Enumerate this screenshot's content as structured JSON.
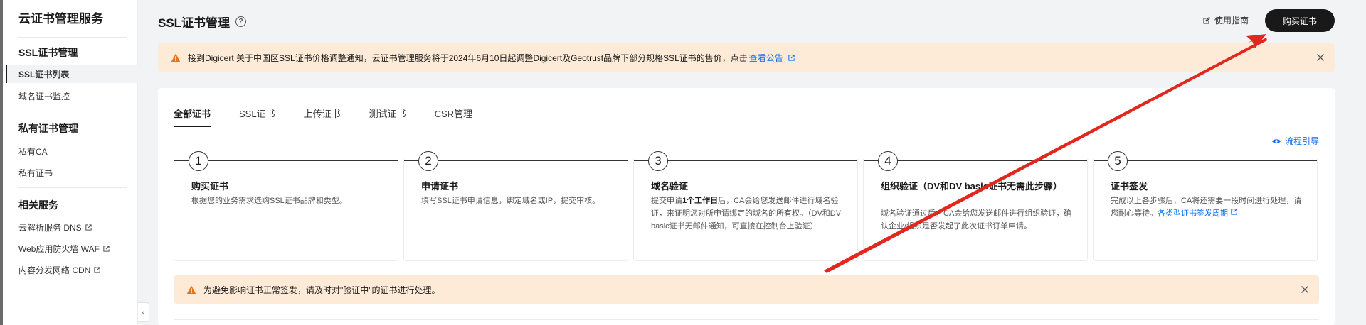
{
  "sidebar": {
    "title": "云证书管理服务",
    "groups": [
      {
        "label": "SSL证书管理",
        "items": [
          {
            "label": "SSL证书列表",
            "active": true
          },
          {
            "label": "域名证书监控"
          }
        ]
      },
      {
        "label": "私有证书管理",
        "items": [
          {
            "label": "私有CA"
          },
          {
            "label": "私有证书"
          }
        ]
      },
      {
        "label": "相关服务",
        "items": [
          {
            "label": "云解析服务 DNS",
            "external": true
          },
          {
            "label": "Web应用防火墙 WAF",
            "external": true
          },
          {
            "label": "内容分发网络 CDN",
            "external": true
          }
        ]
      }
    ]
  },
  "header": {
    "title": "SSL证书管理",
    "guide_label": "使用指南",
    "buy_label": "购买证书"
  },
  "top_notice": {
    "text": "接到Digicert 关于中国区SSL证书价格调整通知，云证书管理服务将于2024年6月10日起调整Digicert及Geotrust品牌下部分规格SSL证书的售价，点击",
    "link": "查看公告"
  },
  "tabs": [
    {
      "label": "全部证书",
      "active": true
    },
    {
      "label": "SSL证书"
    },
    {
      "label": "上传证书"
    },
    {
      "label": "测试证书"
    },
    {
      "label": "CSR管理"
    }
  ],
  "flow_link": "流程引导",
  "steps": [
    {
      "num": "1",
      "title": "购买证书",
      "desc": "根据您的业务需求选购SSL证书品牌和类型。"
    },
    {
      "num": "2",
      "title": "申请证书",
      "desc": "填写SSL证书申请信息，绑定域名或IP，提交审核。"
    },
    {
      "num": "3",
      "title": "域名验证",
      "desc_pre": "提交申请",
      "desc_bold": "1个工作日",
      "desc_post": "后，CA会给您发送邮件进行域名验证，来证明您对所申请绑定的域名的所有权。（DV和DV basic证书无邮件通知，可直接在控制台上验证）"
    },
    {
      "num": "4",
      "title": "组织验证（DV和DV basic证书无需此步骤）",
      "desc": "域名验证通过后，CA会给您发送邮件进行组织验证，确认企业/组织是否发起了此次证书订单申请。"
    },
    {
      "num": "5",
      "title": "证书签发",
      "desc": "完成以上各步骤后，CA将还需要一段时间进行处理，请您耐心等待。",
      "link": "各类型证书签发周期"
    }
  ],
  "bottom_notice": {
    "text": "为避免影响证书正常签发，请及时对\"验证中\"的证书进行处理。"
  },
  "colors": {
    "accent": "#0a6ef0",
    "warning_bg": "#fdebd8",
    "warning_icon": "#e37318",
    "annotation_arrow": "#e0281e"
  }
}
